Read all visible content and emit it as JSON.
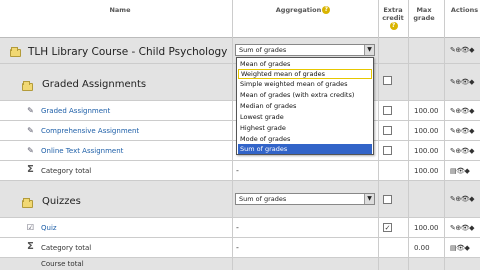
{
  "header": {
    "name": "Name",
    "aggregation": "Aggregation",
    "extra_credit_1": "Extra",
    "extra_credit_2": "credit",
    "max_grade_1": "Max",
    "max_grade_2": "grade",
    "actions": "Actions"
  },
  "course": {
    "title": "TLH Library Course - Child Psychology",
    "aggregation_value": "Sum of grades"
  },
  "aggregation_options": [
    "Mean of grades",
    "Weighted mean of grades",
    "Simple weighted mean of grades",
    "Mean of grades (with extra credits)",
    "Median of grades",
    "Lowest grade",
    "Highest grade",
    "Mode of grades",
    "Sum of grades"
  ],
  "categories": [
    {
      "title": "Graded Assignments",
      "items": [
        {
          "name": "Graded Assignment",
          "max": "100.00"
        },
        {
          "name": "Comprehensive Assignment",
          "max": "100.00"
        },
        {
          "name": "Online Text Assignment",
          "max": "100.00"
        }
      ],
      "total_label": "Category total",
      "total_dash": "-",
      "total_max": "100.00"
    },
    {
      "title": "Quizzes",
      "aggregation_value": "Sum of grades",
      "items": [
        {
          "name": "Quiz",
          "dash": "-",
          "max": "100.00"
        }
      ],
      "total_label": "Category total",
      "total_dash": "-",
      "total_max": "0.00"
    }
  ],
  "course_total_label": "Course total",
  "check_mark": "✓",
  "icons": {
    "actions": "✎⊕👁◆",
    "total_actions": "▤👁◆"
  }
}
